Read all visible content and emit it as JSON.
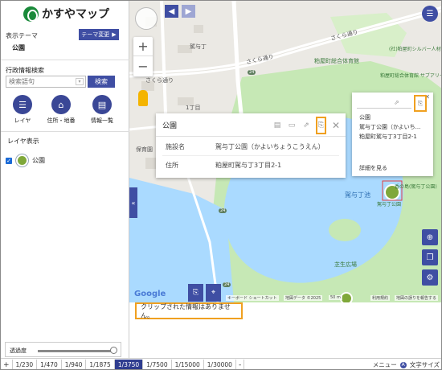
{
  "app": {
    "title": "かすやマップ"
  },
  "sidebar": {
    "theme_label": "表示テーマ",
    "theme_button": "テーマ変更",
    "theme_value": "公園",
    "admin_label": "行政情報検索",
    "search_placeholder": "検索語句",
    "search_button": "検索",
    "tools": [
      {
        "label": "レイヤ",
        "icon": "list-icon"
      },
      {
        "label": "住所・地番",
        "icon": "home-icon"
      },
      {
        "label": "情報一覧",
        "icon": "table-icon"
      }
    ],
    "layer_title": "レイヤ表示",
    "layers": [
      {
        "label": "公園",
        "checked": true
      }
    ],
    "opacity_label": "透過度",
    "opacity_value": 0.95
  },
  "map": {
    "labels": [
      {
        "text": "駕与丁"
      },
      {
        "text": "さくら通り"
      },
      {
        "text": "さくら通り"
      },
      {
        "text": "さくら通り"
      },
      {
        "text": "粕屋町総合体育館"
      },
      {
        "text": "(社)粕屋町シルバー人材センター"
      },
      {
        "text": "粕屋町総合体育館 サブアリーナ"
      },
      {
        "text": "1丁目"
      },
      {
        "text": "保育園"
      },
      {
        "text": "駕与丁池"
      },
      {
        "text": "駕与丁公園"
      },
      {
        "text": "香の島(駕与丁公園)"
      },
      {
        "text": "芝生広場"
      },
      {
        "text": "24"
      },
      {
        "text": "24"
      },
      {
        "text": "24"
      }
    ],
    "attribution": {
      "google": "Google",
      "shortcuts": "キーボード ショートカット",
      "data": "地図データ ©2025",
      "scale": "50 m",
      "terms": "利用規約",
      "report": "地図の誤りを報告する"
    }
  },
  "popup": {
    "title": "公園",
    "rows": [
      {
        "key": "施設名",
        "value": "駕与丁公園（かよいちょうこうえん）"
      },
      {
        "key": "住所",
        "value": "粕屋町駕与丁3丁目2-1"
      }
    ]
  },
  "card": {
    "lines": [
      "公園",
      "駕与丁公園（かよいち...",
      "粕屋町駕与丁3丁目2-1"
    ],
    "link": "詳細を見る"
  },
  "clip_message": "クリップされた情報はありません。",
  "scale_bar": {
    "items": [
      "+",
      "1/230",
      "1/470",
      "1/940",
      "1/1875",
      "1/3750",
      "1/7500",
      "1/15000",
      "1/30000",
      "-"
    ],
    "active": "1/3750",
    "menu": "メニュー",
    "text_size": "文字サイズ"
  },
  "colors": {
    "accent": "#3f4ea3",
    "highlight": "#f0a020",
    "water": "#aadaff",
    "park": "#c6e8b5"
  }
}
